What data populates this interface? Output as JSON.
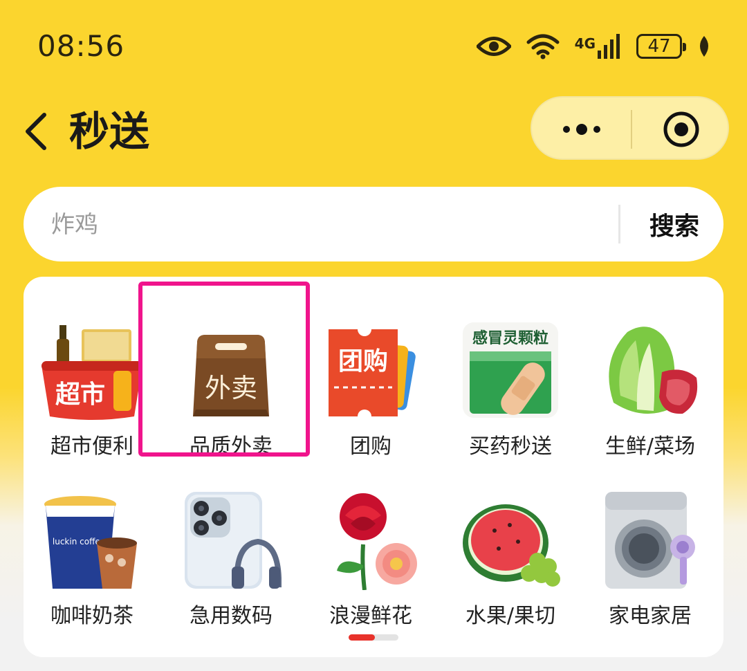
{
  "status_bar": {
    "time": "08:56",
    "network": "4G",
    "battery": "47",
    "icons": [
      "eye-icon",
      "wifi-icon",
      "signal-icon",
      "battery-icon",
      "leaf-icon"
    ]
  },
  "header": {
    "title": "秒送",
    "back_icon": "chevron-left-icon",
    "more_icon": "more-dots-icon",
    "close_icon": "target-close-icon"
  },
  "search": {
    "placeholder": "炸鸡",
    "button_label": "搜索"
  },
  "categories": [
    {
      "label": "超市便利",
      "icon": "supermarket-icon"
    },
    {
      "label": "品质外卖",
      "icon": "takeout-bag-icon"
    },
    {
      "label": "团购",
      "icon": "group-buy-ticket-icon"
    },
    {
      "label": "买药秒送",
      "icon": "medicine-box-icon"
    },
    {
      "label": "生鲜/菜场",
      "icon": "vegetable-meat-icon"
    },
    {
      "label": "咖啡奶茶",
      "icon": "coffee-cup-icon"
    },
    {
      "label": "急用数码",
      "icon": "phone-headphones-icon"
    },
    {
      "label": "浪漫鲜花",
      "icon": "flower-icon"
    },
    {
      "label": "水果/果切",
      "icon": "watermelon-icon"
    },
    {
      "label": "家电家居",
      "icon": "washing-machine-icon"
    }
  ],
  "takeout_text": "外卖",
  "group_buy_text": "团购",
  "supermarket_text": "超市",
  "medicine_text": "感冒灵颗粒",
  "coffee_text": "luckin coffee",
  "highlight": {
    "selected_category": "品质外卖",
    "color": "#F0148C"
  },
  "pager": {
    "pages": 2,
    "current": 1,
    "active_color": "#E8322B"
  },
  "colors": {
    "header_bg": "#FBD52E",
    "capsule_bg": "#FDEFA6"
  }
}
